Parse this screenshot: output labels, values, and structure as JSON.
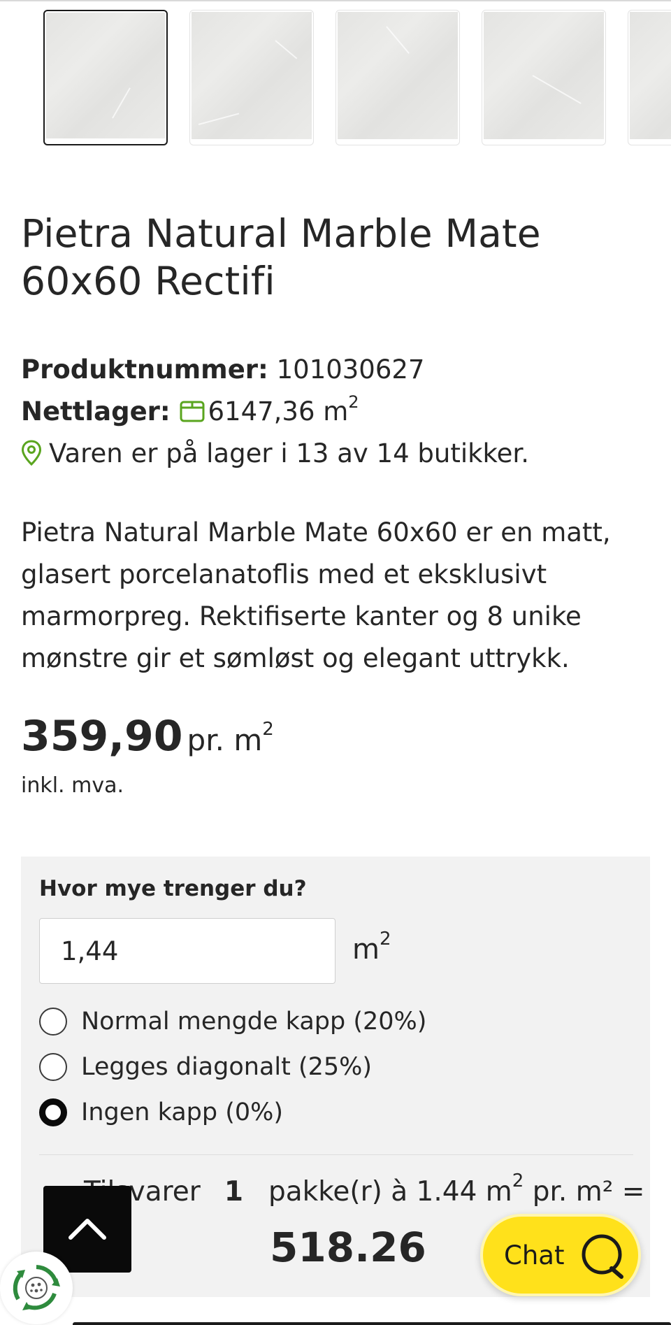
{
  "product": {
    "title": "Pietra Natural Marble Mate 60x60 Rectifi",
    "sku_label": "Produktnummer:",
    "sku_value": "101030627",
    "stock_label": "Nettlager:",
    "stock_value": "6147,36 m",
    "stock_unit_sup": "2",
    "store_availability": "Varen er på lager i 13 av 14 butikker.",
    "description": "Pietra Natural Marble Mate 60x60 er en matt, glasert porcelanatoflis med et eksklusivt marmorpreg. Rektifiserte kanter og 8 unike mønstre gir et sømløst og elegant uttrykk.",
    "price": "359,90",
    "price_unit": "pr. m",
    "price_unit_sup": "2",
    "vat_note": "inkl. mva."
  },
  "gallery": {
    "thumbnails": [
      {
        "alt": "tile-thumbnail-1",
        "active": true
      },
      {
        "alt": "tile-thumbnail-2",
        "active": false
      },
      {
        "alt": "tile-thumbnail-3",
        "active": false
      },
      {
        "alt": "tile-thumbnail-4",
        "active": false
      },
      {
        "alt": "tile-thumbnail-5",
        "active": false
      }
    ]
  },
  "calculator": {
    "question": "Hvor mye trenger du?",
    "quantity_value": "1,44",
    "quantity_unit": "m",
    "quantity_unit_sup": "2",
    "options": [
      {
        "label": "Normal mengde kapp (20%)",
        "checked": false
      },
      {
        "label": "Legges diagonalt (25%)",
        "checked": false
      },
      {
        "label": "Ingen kapp (0%)",
        "checked": true
      }
    ],
    "summary_prefix": "Tilsvarer",
    "package_count": "1",
    "summary_pack": "pakke(r) à 1.44 m",
    "summary_pack_sup": "2",
    "summary_suffix": " pr. m² =",
    "total": "518.26"
  },
  "chat": {
    "label": "Chat"
  },
  "colors": {
    "accent_yellow": "#ffe11b",
    "stock_green": "#5aa51f",
    "text_dark": "#262626",
    "panel_grey": "#f2f2f2"
  }
}
